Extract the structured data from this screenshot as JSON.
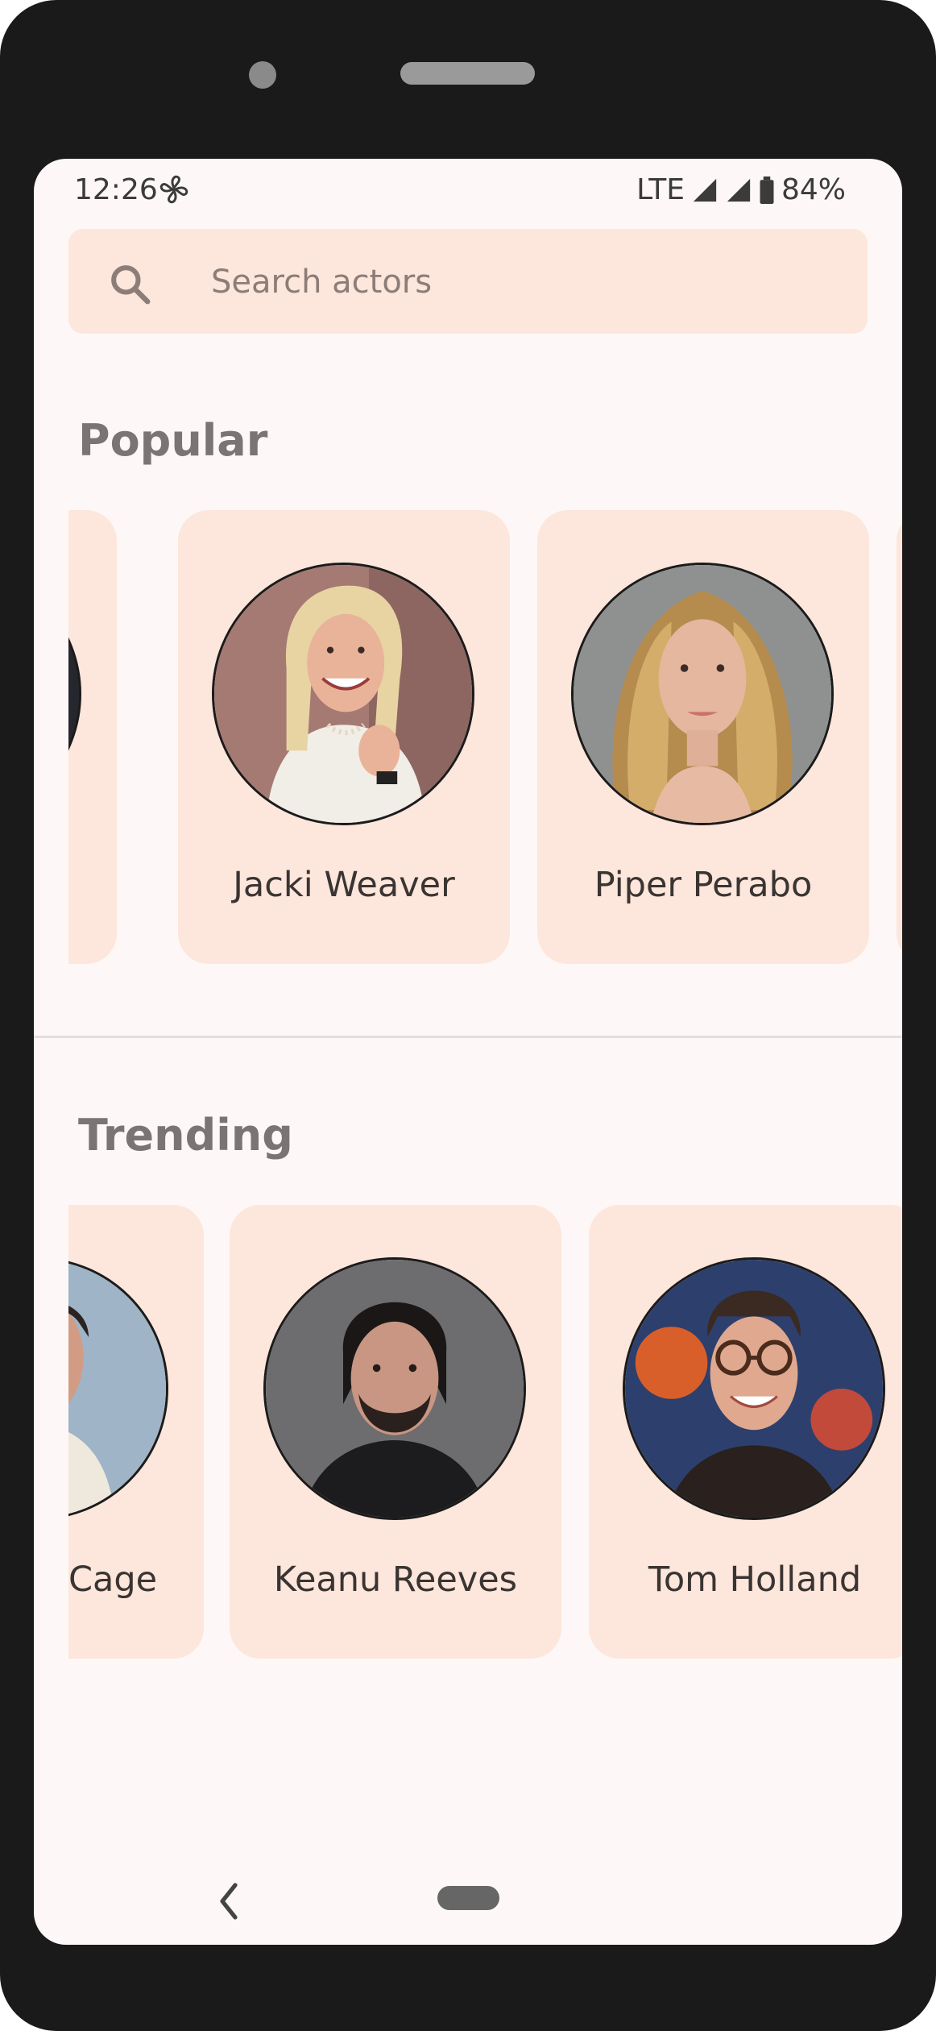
{
  "status": {
    "time": "12:26",
    "network": "LTE",
    "battery": "84%",
    "icons": [
      "fan-icon",
      "signal-icon",
      "signal-icon",
      "battery-icon"
    ]
  },
  "search": {
    "placeholder": "Search actors",
    "icon": "search-icon"
  },
  "sections": {
    "popular": {
      "title": "Popular",
      "actors": [
        {
          "name": ""
        },
        {
          "name": "Jacki Weaver"
        },
        {
          "name": "Piper Perabo"
        },
        {
          "name": ""
        }
      ]
    },
    "trending": {
      "title": "Trending",
      "actors": [
        {
          "name": "Cage"
        },
        {
          "name": "Keanu Reeves"
        },
        {
          "name": "Tom Holland"
        }
      ]
    }
  },
  "navbar": {
    "icons": [
      "back-icon",
      "home-pill"
    ]
  },
  "colors": {
    "frame": "#1a1a1a",
    "screen_bg": "#fdf8f7",
    "card_bg": "#fde6db",
    "text_dark": "#3a3432",
    "section_title": "#7a7574"
  }
}
